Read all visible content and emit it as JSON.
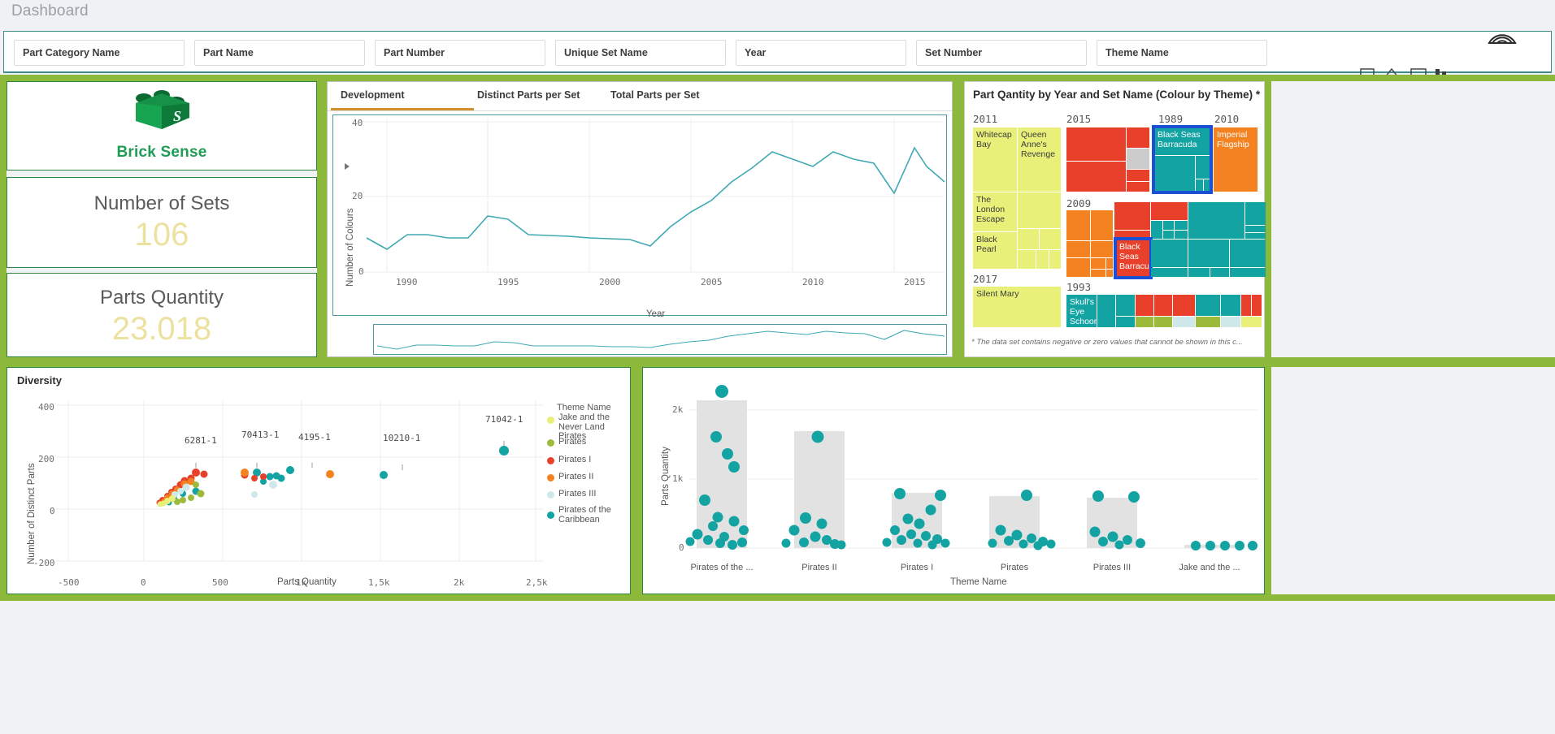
{
  "header": {
    "title": "Dashboard"
  },
  "filters": [
    {
      "label": "Part Category Name",
      "fill": 0.72,
      "offset": 0.0,
      "accent": "grey"
    },
    {
      "label": "Part Name",
      "fill": 0.96,
      "offset": 0.02,
      "accent": "grey"
    },
    {
      "label": "Part Number",
      "fill": 0.97,
      "offset": 0.02,
      "accent": "grey"
    },
    {
      "label": "Unique Set Name",
      "fill": 1.0,
      "offset": 0.0,
      "accent": "none"
    },
    {
      "label": "Year",
      "fill": 0.7,
      "offset": 0.16,
      "accent": "grey"
    },
    {
      "label": "Set Number",
      "fill": 0.98,
      "offset": 0.01,
      "accent": "grey"
    },
    {
      "label": "Theme Name",
      "fill": 0.0,
      "offset": 0.0,
      "accent": "green"
    }
  ],
  "brand": {
    "name": "Brick Sense",
    "letter": "S",
    "color": "#17974a"
  },
  "kpis": [
    {
      "title": "Number of Sets",
      "value": "106"
    },
    {
      "title": "Parts Quantity",
      "value": "23.018"
    }
  ],
  "line_panel": {
    "tabs": [
      {
        "label": "Development",
        "active": true
      },
      {
        "label": "Distinct Parts per Set",
        "active": false
      },
      {
        "label": "Total Parts per Set",
        "active": false
      }
    ]
  },
  "treemap": {
    "title": "Part Qantity by Year and Set Name (Colour by Theme) *",
    "note": "* The data set contains negative or zero values that cannot be shown in this c...",
    "year_groups": [
      "2011",
      "2015",
      "1989",
      "2010",
      "2009",
      "2017",
      "1993"
    ],
    "labeled_tiles": [
      "Whitecap Bay",
      "Queen Anne's Revenge",
      "The London Escape",
      "Black Pearl",
      "Silent Mary",
      "Black Seas Barracuda",
      "Imperial Flagship",
      "Skull's Eye Schooner",
      "Black Seas Barracuda"
    ],
    "selected": [
      "Black Seas Barracuda",
      "Black Seas Barracuda"
    ],
    "theme_colors": {
      "Jake and the Never Land Pirates": "#e8f07a",
      "Pirates": "#9cbb3b",
      "Pirates I": "#e8402a",
      "Pirates II": "#f58220",
      "Pirates III": "#cfe9ea",
      "Pirates of the Caribbean": "#14a3a3",
      "Null": "#cccccc"
    }
  },
  "scatter": {
    "title": "Diversity",
    "xlabel": "Parts Quantity",
    "ylabel": "Number of Distinct Parts",
    "legend_title": "Theme Name",
    "legend": [
      {
        "label": "Jake and the Never Land Pirates",
        "color": "#e8f07a"
      },
      {
        "label": "Pirates",
        "color": "#9cbb3b"
      },
      {
        "label": "Pirates I",
        "color": "#e8402a"
      },
      {
        "label": "Pirates II",
        "color": "#f58220"
      },
      {
        "label": "Pirates III",
        "color": "#cfe9ea"
      },
      {
        "label": "Pirates of the Caribbean",
        "color": "#14a3a3"
      }
    ]
  },
  "boxplot": {
    "xlabel": "Theme Name",
    "ylabel": "Parts Quantity"
  },
  "chart_data": [
    {
      "type": "line",
      "title": "Development",
      "xlabel": "Year",
      "ylabel": "Number of Colours",
      "xlim": [
        1988,
        2017
      ],
      "ylim": [
        0,
        40
      ],
      "yticks": [
        0,
        20,
        40
      ],
      "xticks": [
        1990,
        1995,
        2000,
        2005,
        2010,
        2015
      ],
      "grid": true,
      "legend": "none",
      "series": [
        {
          "name": "Number of Colours",
          "color": "#3fa9b4",
          "x": [
            1988,
            1989,
            1990,
            1991,
            1992,
            1993,
            1994,
            1995,
            1996,
            1997,
            1998,
            1999,
            2000,
            2001,
            2002,
            2003,
            2004,
            2005,
            2006,
            2007,
            2008,
            2009,
            2010,
            2011,
            2012,
            2013,
            2014,
            2015,
            2016,
            2017
          ],
          "y": [
            9,
            6,
            10,
            10,
            9,
            9,
            15,
            14,
            10,
            10,
            9.5,
            9.5,
            9,
            9,
            7,
            12,
            16,
            19,
            24,
            28,
            32,
            30,
            28,
            32,
            30,
            29,
            21,
            33,
            28,
            24
          ]
        }
      ]
    },
    {
      "type": "scatter",
      "title": "Diversity",
      "xlabel": "Parts Quantity",
      "ylabel": "Number of Distinct Parts",
      "xlim": [
        -500,
        2500
      ],
      "ylim": [
        -200,
        400
      ],
      "xticks": [
        -500,
        0,
        500,
        1000,
        1500,
        2000,
        2500
      ],
      "xticklabels": [
        "-500",
        "0",
        "500",
        "1k",
        "1.5k",
        "2k",
        "2.5k"
      ],
      "yticks": [
        -200,
        0,
        200,
        400
      ],
      "grid": true,
      "annotations": [
        {
          "text": "71042-1",
          "x": 2290,
          "y": 280
        },
        {
          "text": "6281-1",
          "x": 330,
          "y": 180
        },
        {
          "text": "70413-1",
          "x": 690,
          "y": 195
        },
        {
          "text": "4195-1",
          "x": 930,
          "y": 190
        },
        {
          "text": "10210-1",
          "x": 1420,
          "y": 185
        }
      ],
      "series": [
        {
          "name": "Pirates of the Caribbean",
          "color": "#14a3a3",
          "points": [
            [
              2290,
              225
            ],
            [
              930,
              150
            ],
            [
              1420,
              130
            ],
            [
              720,
              140
            ],
            [
              800,
              125
            ],
            [
              760,
              105
            ],
            [
              840,
              128
            ],
            [
              870,
              120
            ],
            [
              330,
              70
            ],
            [
              250,
              60
            ],
            [
              190,
              40
            ],
            [
              160,
              25
            ]
          ]
        },
        {
          "name": "Pirates I",
          "color": "#e8402a",
          "points": [
            [
              330,
              140
            ],
            [
              380,
              135
            ],
            [
              300,
              120
            ],
            [
              260,
              110
            ],
            [
              230,
              95
            ],
            [
              200,
              80
            ],
            [
              175,
              65
            ],
            [
              150,
              50
            ],
            [
              120,
              35
            ],
            [
              100,
              25
            ],
            [
              640,
              130
            ],
            [
              700,
              120
            ],
            [
              760,
              125
            ]
          ]
        },
        {
          "name": "Pirates II",
          "color": "#f58220",
          "points": [
            [
              1180,
              135
            ],
            [
              640,
              140
            ],
            [
              300,
              105
            ],
            [
              260,
              95
            ],
            [
              210,
              75
            ],
            [
              180,
              60
            ],
            [
              150,
              45
            ],
            [
              130,
              30
            ],
            [
              110,
              22
            ]
          ]
        },
        {
          "name": "Pirates III",
          "color": "#cfe9ea",
          "points": [
            [
              820,
              95
            ],
            [
              700,
              55
            ],
            [
              270,
              85
            ],
            [
              230,
              70
            ],
            [
              195,
              55
            ]
          ]
        },
        {
          "name": "Pirates",
          "color": "#9cbb3b",
          "points": [
            [
              360,
              60
            ],
            [
              300,
              45
            ],
            [
              250,
              35
            ],
            [
              210,
              28
            ],
            [
              330,
              95
            ]
          ]
        },
        {
          "name": "Jake and the Never Land Pirates",
          "color": "#e8f07a",
          "points": [
            [
              180,
              40
            ],
            [
              150,
              30
            ],
            [
              125,
              22
            ],
            [
              105,
              18
            ]
          ]
        }
      ]
    },
    {
      "type": "scatter",
      "title": "",
      "xlabel": "Theme Name",
      "ylabel": "Parts Quantity",
      "categories": [
        "Pirates of the ...",
        "Pirates II",
        "Pirates I",
        "Pirates",
        "Pirates III",
        "Jake and the ..."
      ],
      "yticks": [
        0,
        1000,
        2000
      ],
      "yticklabels": [
        "0",
        "1k",
        "2k"
      ],
      "ylim": [
        -200,
        2400
      ],
      "grid": true,
      "boxes": [
        {
          "category": "Pirates of the ...",
          "low": 0,
          "high": 2150
        },
        {
          "category": "Pirates II",
          "low": 0,
          "high": 1700
        },
        {
          "category": "Pirates I",
          "low": 0,
          "high": 800
        },
        {
          "category": "Pirates",
          "low": 0,
          "high": 760
        },
        {
          "category": "Pirates III",
          "low": 0,
          "high": 730
        },
        {
          "category": "Jake and the ...",
          "low": 0,
          "high": 40
        }
      ],
      "dot_color": "#14a3a3",
      "points": {
        "Pirates of the ...": [
          2290,
          1620,
          1370,
          1180,
          700,
          470,
          400,
          200,
          120,
          60,
          40,
          30,
          70,
          330,
          150,
          90
        ],
        "Pirates II": [
          1620,
          420,
          340,
          260,
          180,
          120,
          80,
          60,
          40,
          30,
          430,
          200
        ],
        "Pirates I": [
          840,
          830,
          460,
          360,
          300,
          220,
          170,
          140,
          110,
          80,
          60,
          40,
          250,
          180
        ],
        "Pirates": [
          810,
          300,
          200,
          150,
          110,
          80,
          55,
          35,
          120,
          180
        ],
        "Pirates III": [
          760,
          740,
          180,
          120,
          80,
          50,
          30,
          100
        ],
        "Jake and the ...": [
          30,
          25,
          20,
          18,
          15
        ]
      }
    }
  ]
}
